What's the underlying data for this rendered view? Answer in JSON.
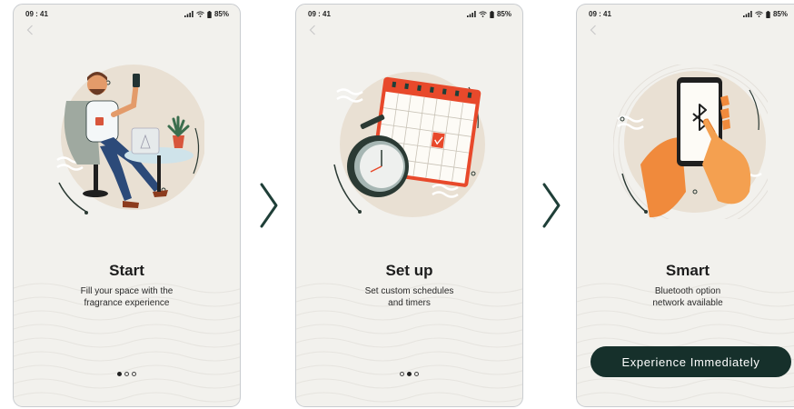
{
  "screens": [
    {
      "status": {
        "time": "09 : 41",
        "battery": "85%"
      },
      "title": "Start",
      "desc_lines": [
        "Fill your space with the",
        "fragrance experience"
      ],
      "dots": [
        true,
        false,
        false
      ]
    },
    {
      "status": {
        "time": "09 : 41",
        "battery": "85%"
      },
      "title": "Set up",
      "desc_lines": [
        "Set custom schedules",
        "and timers"
      ],
      "dots": [
        false,
        true,
        false
      ]
    },
    {
      "status": {
        "time": "09 : 41",
        "battery": "85%"
      },
      "title": "Smart",
      "desc_lines": [
        "Bluetooth option",
        "network available"
      ],
      "button_label": "Experience Immediately"
    }
  ],
  "icons": {
    "back": "chevron-left-icon",
    "next": "chevron-right-icon",
    "signal": "signal-icon",
    "wifi": "wifi-icon",
    "battery": "battery-icon",
    "bluetooth": "bluetooth-icon"
  },
  "colors": {
    "screen_bg": "#f2f1ed",
    "illustration_circle": "#e9e0d3",
    "accent_orange": "#f08a3c",
    "accent_red": "#e8492b",
    "dark_green": "#16302b",
    "text": "#1d1d1d"
  }
}
